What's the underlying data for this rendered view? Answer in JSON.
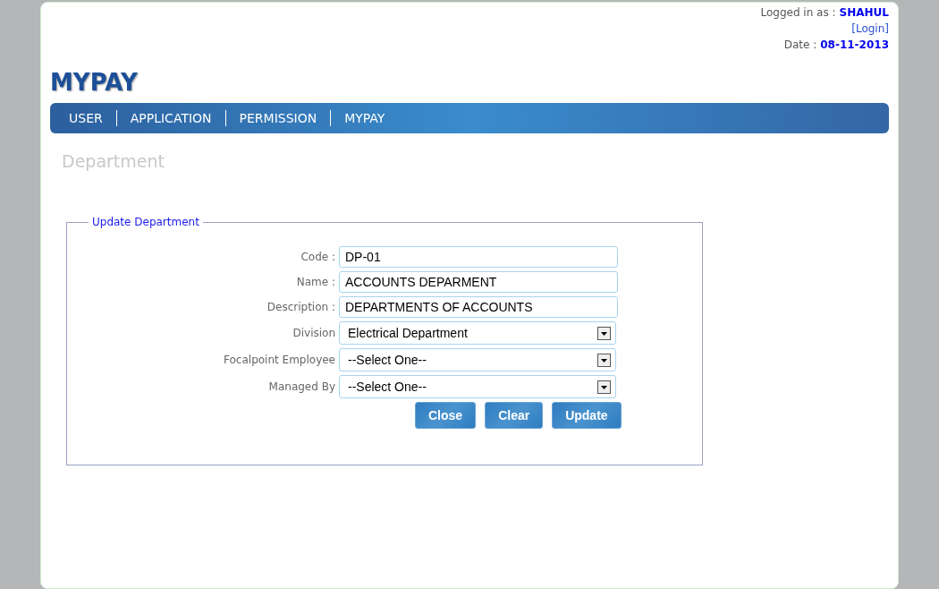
{
  "header": {
    "logged_in_label": "Logged in as :",
    "user": "SHAHUL",
    "login_link": "[Login]",
    "date_label": "Date :",
    "date": "08-11-2013"
  },
  "logo": "MYPAY",
  "nav": [
    {
      "label": "USER"
    },
    {
      "label": "APPLICATION"
    },
    {
      "label": "PERMISSION"
    },
    {
      "label": "MYPAY"
    }
  ],
  "page_title": "Department",
  "form": {
    "legend": "Update Department",
    "fields": [
      {
        "kind": "text",
        "label": "Code :",
        "value": "DP-01"
      },
      {
        "kind": "text",
        "label": "Name :",
        "value": "ACCOUNTS DEPARMENT"
      },
      {
        "kind": "text",
        "label": "Description :",
        "value": "DEPARTMENTS OF ACCOUNTS"
      },
      {
        "kind": "select",
        "label": "Division",
        "value": "Electrical Department"
      },
      {
        "kind": "select",
        "label": "Focalpoint Employee",
        "value": "--Select One--"
      },
      {
        "kind": "select",
        "label": "Managed By",
        "value": "--Select One--"
      }
    ],
    "buttons": [
      "Close",
      "Clear",
      "Update"
    ]
  }
}
